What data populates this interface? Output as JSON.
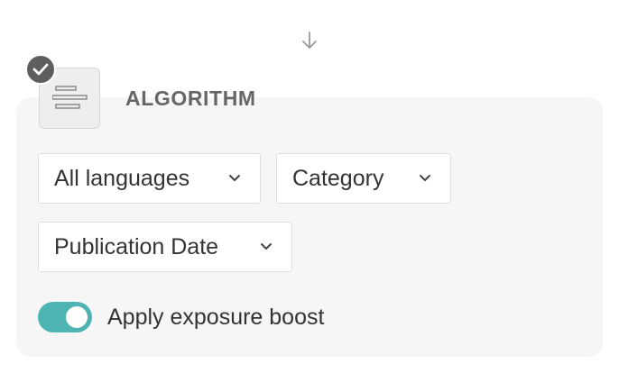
{
  "flow": {
    "connector_icon": "arrow-down-icon"
  },
  "algorithm": {
    "status_icon": "check-icon",
    "icon": "align-center-icon",
    "title": "ALGORITHM"
  },
  "filters": {
    "language": {
      "selected": "All languages",
      "icon": "chevron-down-icon"
    },
    "category": {
      "selected": "Category",
      "icon": "chevron-down-icon"
    },
    "publication_date": {
      "selected": "Publication Date",
      "icon": "chevron-down-icon"
    }
  },
  "exposure_boost": {
    "label": "Apply exposure boost",
    "enabled": true
  },
  "colors": {
    "accent": "#4db3b3",
    "badge": "#5e5e5e",
    "card_background": "#f6f6f6"
  }
}
